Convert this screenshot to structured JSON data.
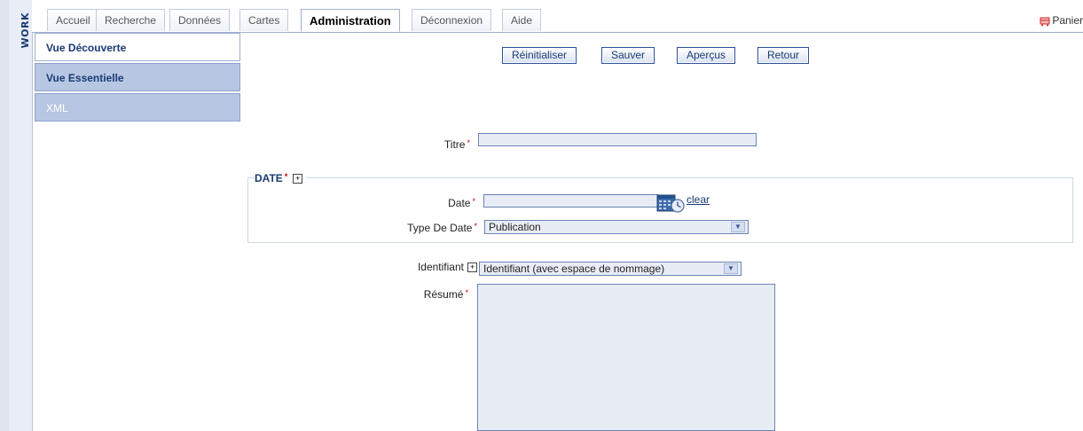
{
  "sidebar_strip": {
    "label": "WORK"
  },
  "tabs": [
    {
      "label": "Accueil"
    },
    {
      "label": "Recherche"
    },
    {
      "label": "Données"
    },
    {
      "label": "Cartes"
    },
    {
      "label": "Administration",
      "active": true
    },
    {
      "label": "Déconnexion"
    },
    {
      "label": "Aide"
    }
  ],
  "basket": {
    "label": "Panier"
  },
  "leftnav": {
    "items": [
      {
        "label": "Vue Découverte",
        "active": true
      },
      {
        "label": "Vue Essentielle"
      },
      {
        "label": "XML"
      }
    ]
  },
  "actions": {
    "reset": "Réinitialiser",
    "save": "Sauver",
    "preview": "Aperçus",
    "back": "Retour"
  },
  "form": {
    "title_label": "Titre",
    "title_value": "",
    "date_section": {
      "legend": "DATE",
      "plus": "+",
      "date_label": "Date",
      "date_value": "",
      "clear": "clear",
      "type_label": "Type De Date",
      "type_value": "Publication"
    },
    "identifier_label": "Identifiant",
    "identifier_plus": "+",
    "identifier_value": "Identifiant (avec espace de nommage)",
    "abstract_label": "Résumé",
    "abstract_value": ""
  },
  "required_marker": "*",
  "colors": {
    "accent": "#1a3a73",
    "nav_inactive": "#b7c6e3",
    "input_bg": "#e8edf5",
    "required": "#d00000"
  }
}
